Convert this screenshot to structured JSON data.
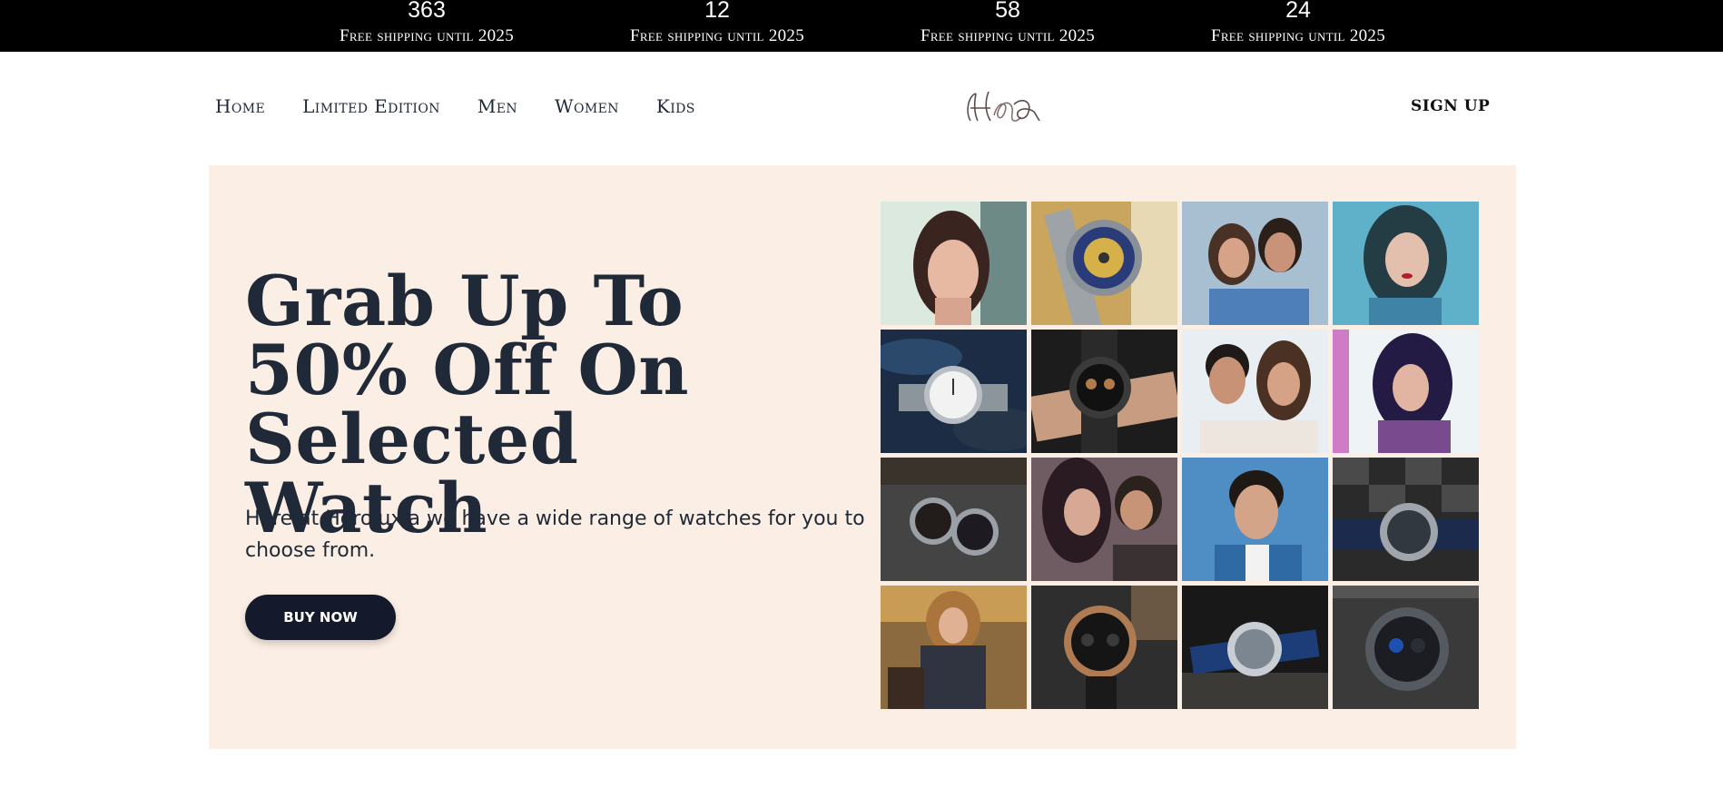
{
  "topbar": {
    "counters": [
      {
        "value": "363",
        "label": "Free shipping until 2025"
      },
      {
        "value": "12",
        "label": "Free shipping until 2025"
      },
      {
        "value": "58",
        "label": "Free shipping until 2025"
      },
      {
        "value": "24",
        "label": "Free shipping until 2025"
      }
    ]
  },
  "nav": {
    "links": [
      "Home",
      "Limited Edition",
      "Men",
      "Women",
      "Kids"
    ],
    "logo_text": "H&a",
    "signup_label": "SIGN UP"
  },
  "hero": {
    "title": "Grab Up To 50% Off On Selected Watch",
    "description": "Here at Horoluxia we have a wide range of watches for you to choose from.",
    "button_label": "BUY NOW"
  },
  "gallery": {
    "tiles": [
      "woman-portrait",
      "gold-skeleton-watch",
      "couple-photo",
      "woman-blue-portrait",
      "silver-watch-on-rock",
      "black-chronograph-wrist",
      "couple-photo",
      "woman-pink-portrait",
      "pair-of-watches",
      "couple-embrace",
      "man-portrait",
      "skeleton-watch-checkered",
      "woman-outdoor",
      "rose-gold-chronograph",
      "blue-strap-skeleton-watch",
      "black-sport-watch"
    ]
  },
  "colors": {
    "topbar_bg": "#000000",
    "hero_bg": "#fbeee4",
    "button_bg": "#141a2b",
    "text": "#1f2937"
  }
}
